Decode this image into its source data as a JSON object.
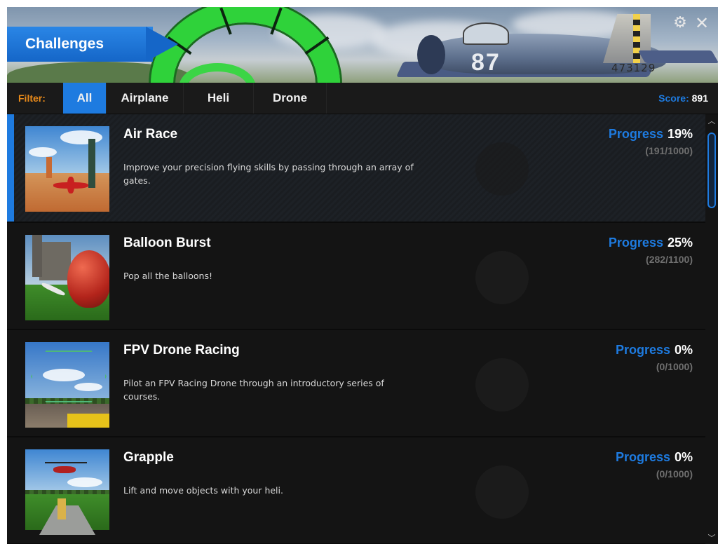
{
  "window": {
    "title": "Challenges",
    "settings_icon": "gear-icon",
    "close_icon": "close-icon"
  },
  "banner": {
    "plane_marking": "87",
    "tail_number": "473129"
  },
  "filter": {
    "label": "Filter:",
    "tabs": [
      {
        "label": "All",
        "active": true
      },
      {
        "label": "Airplane",
        "active": false
      },
      {
        "label": "Heli",
        "active": false
      },
      {
        "label": "Drone",
        "active": false
      }
    ],
    "score_label": "Score:",
    "score_value": "891"
  },
  "challenges": [
    {
      "title": "Air Race",
      "description": "Improve your precision flying skills by passing through an array of gates.",
      "progress_label": "Progress",
      "progress_percent": "19%",
      "progress_count": "(191/1000)",
      "selected": true
    },
    {
      "title": "Balloon Burst",
      "description": "Pop all the balloons!",
      "progress_label": "Progress",
      "progress_percent": "25%",
      "progress_count": "(282/1100)",
      "selected": false
    },
    {
      "title": "FPV Drone Racing",
      "description": "Pilot an FPV Racing Drone through an introductory series of courses.",
      "progress_label": "Progress",
      "progress_percent": "0%",
      "progress_count": "(0/1000)",
      "selected": false
    },
    {
      "title": "Grapple",
      "description": "Lift and move objects with your heli.",
      "progress_label": "Progress",
      "progress_percent": "0%",
      "progress_count": "(0/1000)",
      "selected": false
    }
  ],
  "colors": {
    "accent": "#1e7be0",
    "filter_label": "#e88a1a",
    "background": "#141414"
  }
}
